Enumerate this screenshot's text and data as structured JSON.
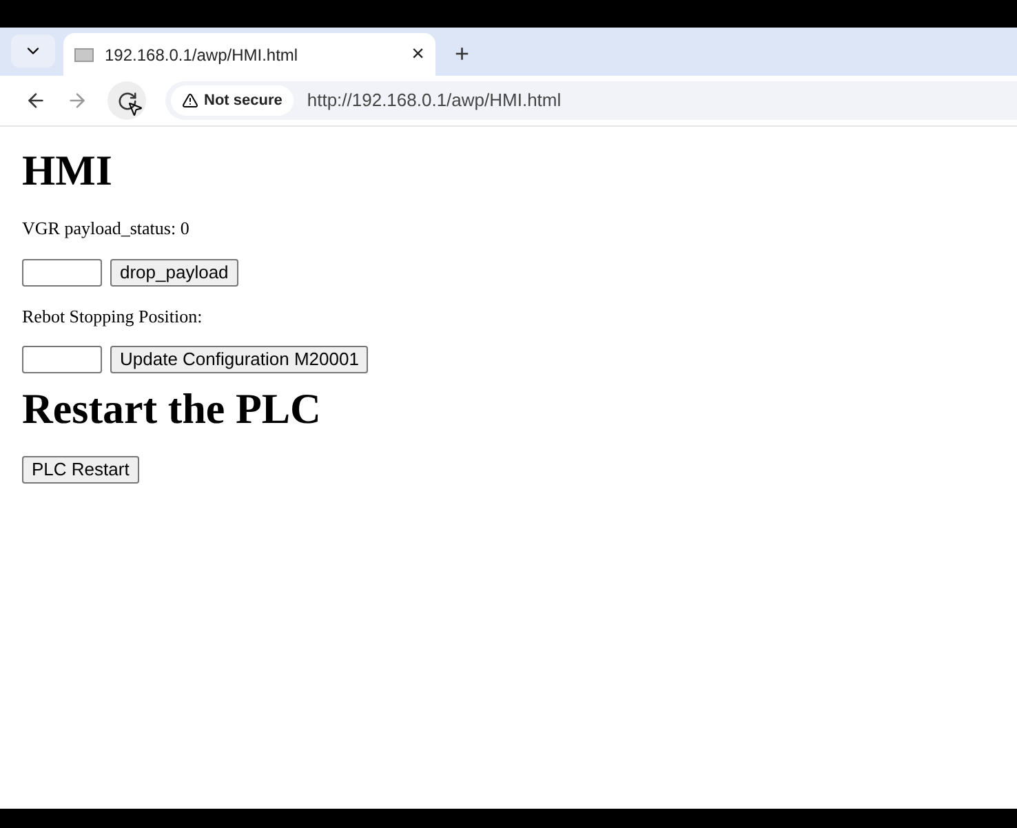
{
  "browser": {
    "tab": {
      "title": "192.168.0.1/awp/HMI.html",
      "close": "×",
      "new_tab": "+"
    },
    "security": "Not secure",
    "url": "http://192.168.0.1/awp/HMI.html"
  },
  "page": {
    "heading": "HMI",
    "status_label": "VGR payload_status: 0",
    "drop_button": "drop_payload",
    "position_label": "Rebot Stopping Position:",
    "update_button": "Update Configuration M20001",
    "restart_heading": "Restart the PLC",
    "restart_button": "PLC Restart"
  }
}
